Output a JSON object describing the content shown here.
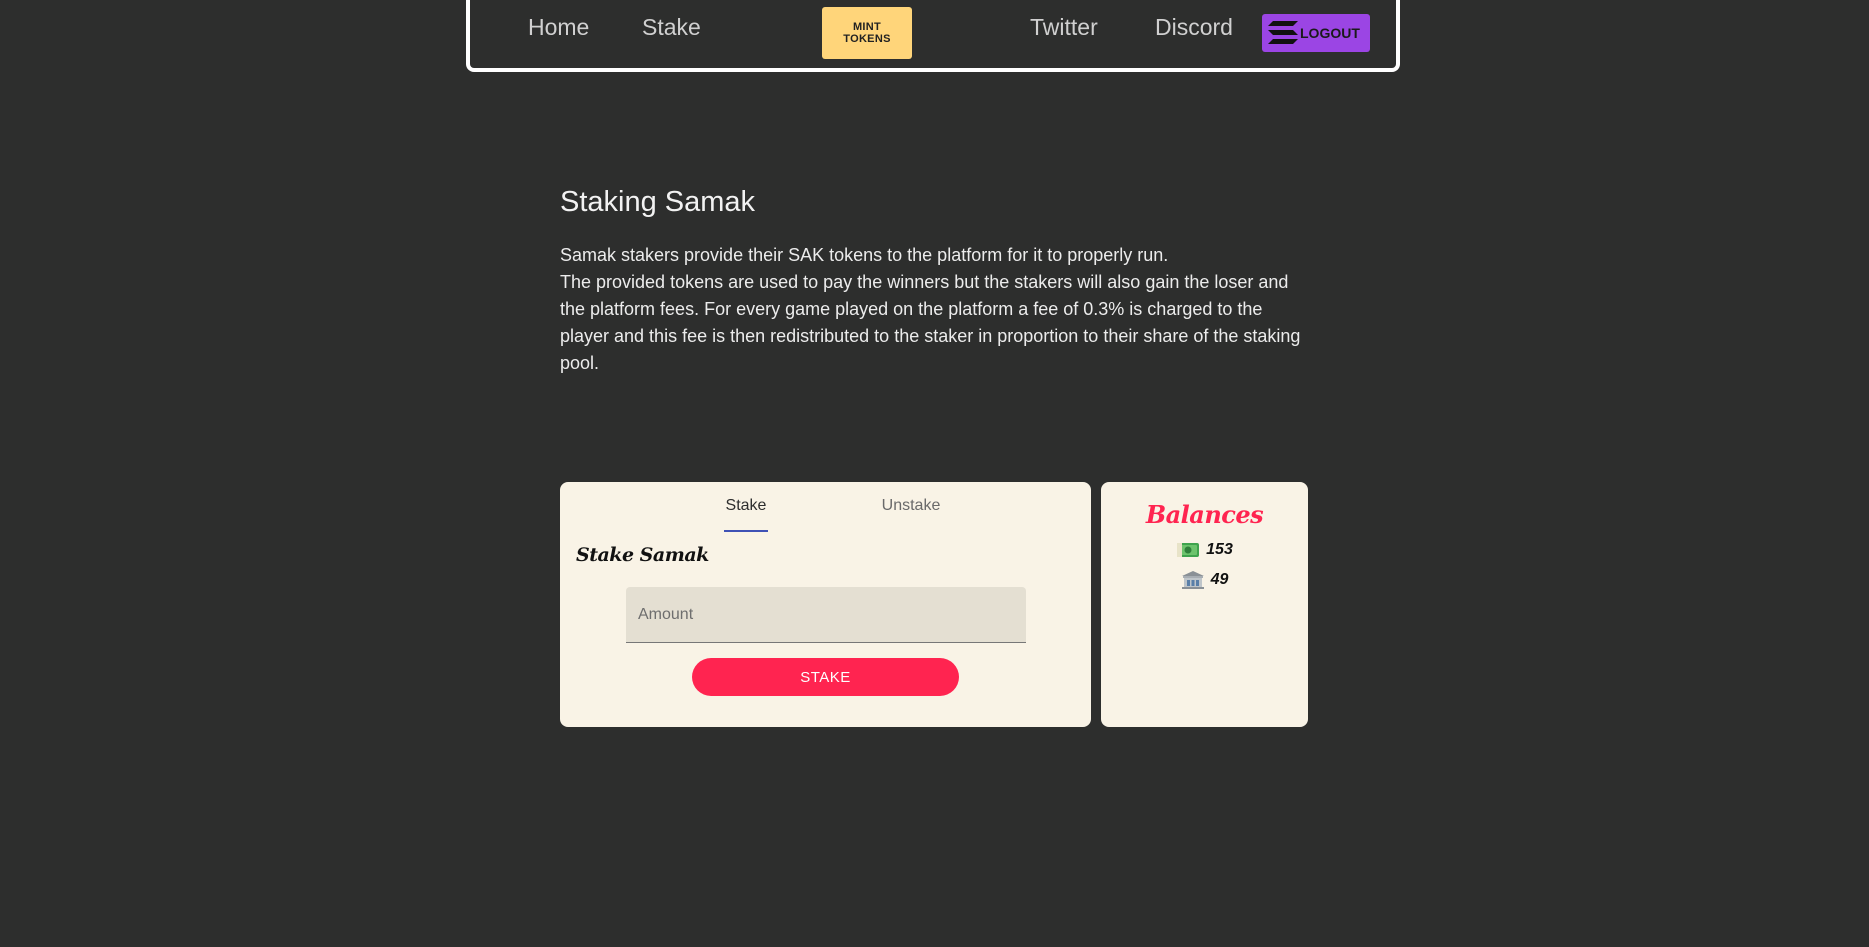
{
  "nav": {
    "home_label": "Home",
    "stake_label": "Stake",
    "mint_label": "MINT TOKENS",
    "twitter_label": "Twitter",
    "discord_label": "Discord",
    "logout_label": "LOGOUT"
  },
  "intro": {
    "title": "Staking Samak",
    "paragraph_1": "Samak stakers provide their SAK tokens to the platform for it to properly run.",
    "paragraph_2": "The provided tokens are used to pay the winners but the stakers will also gain the loser and the platform fees. For every game played on the platform a fee of 0.3% is charged to the player and this fee is then redistributed to the staker in proportion to their share of the staking pool."
  },
  "stake_card": {
    "tabs": [
      {
        "label": "Stake",
        "active": true
      },
      {
        "label": "Unstake",
        "active": false
      }
    ],
    "heading": "Stake Samak",
    "amount_placeholder": "Amount",
    "submit_label": "STAKE"
  },
  "balances": {
    "title": "Balances",
    "items": [
      {
        "icon": "money-icon",
        "value": "153"
      },
      {
        "icon": "bank-icon",
        "value": "49"
      }
    ]
  },
  "colors": {
    "background": "#2d2e2d",
    "card": "#f9f3e6",
    "accent": "#ff2450",
    "mint": "#ffd57a",
    "logout": "#9b45e4",
    "tab_indicator": "#3f51b5"
  }
}
